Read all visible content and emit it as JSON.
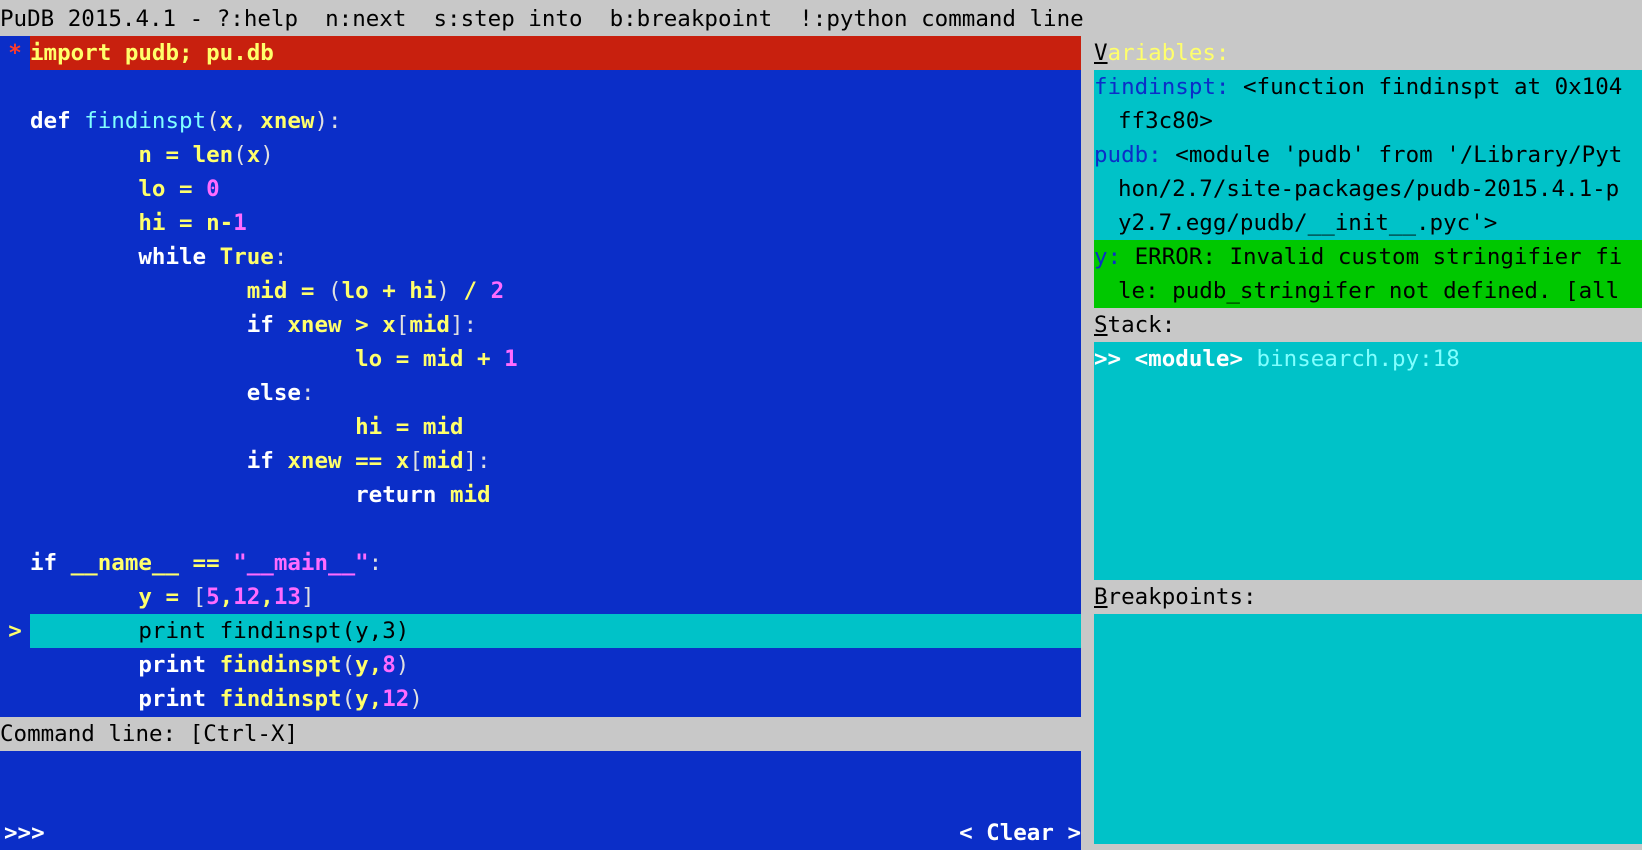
{
  "titlebar": {
    "text": "PuDB 2015.4.1 - ?:help  n:next  s:step into  b:breakpoint  !:python command line"
  },
  "code": {
    "lines": [
      {
        "gutter": "*",
        "kind": "bp",
        "tokens": [
          [
            "bp",
            "import pudb; pu.db"
          ]
        ]
      },
      {
        "gutter": "",
        "kind": "",
        "tokens": []
      },
      {
        "gutter": "",
        "kind": "",
        "tokens": [
          [
            "kw",
            "def "
          ],
          [
            "fn",
            "findinspt"
          ],
          [
            "pu",
            "("
          ],
          [
            "id",
            "x"
          ],
          [
            "pu",
            ", "
          ],
          [
            "id",
            "xnew"
          ],
          [
            "pu",
            "):"
          ]
        ]
      },
      {
        "gutter": "",
        "kind": "",
        "tokens": [
          [
            "pu",
            "        "
          ],
          [
            "id",
            "n"
          ],
          [
            "id",
            " = "
          ],
          [
            "id",
            "len"
          ],
          [
            "pu",
            "("
          ],
          [
            "id",
            "x"
          ],
          [
            "pu",
            ")"
          ]
        ]
      },
      {
        "gutter": "",
        "kind": "",
        "tokens": [
          [
            "pu",
            "        "
          ],
          [
            "id",
            "lo"
          ],
          [
            "id",
            " = "
          ],
          [
            "nm",
            "0"
          ]
        ]
      },
      {
        "gutter": "",
        "kind": "",
        "tokens": [
          [
            "pu",
            "        "
          ],
          [
            "id",
            "hi"
          ],
          [
            "id",
            " = "
          ],
          [
            "id",
            "n-"
          ],
          [
            "nm",
            "1"
          ]
        ]
      },
      {
        "gutter": "",
        "kind": "",
        "tokens": [
          [
            "pu",
            "        "
          ],
          [
            "kw",
            "while "
          ],
          [
            "id",
            "True"
          ],
          [
            "pu",
            ":"
          ]
        ]
      },
      {
        "gutter": "",
        "kind": "",
        "tokens": [
          [
            "pu",
            "                "
          ],
          [
            "id",
            "mid"
          ],
          [
            "id",
            " = "
          ],
          [
            "pu",
            "("
          ],
          [
            "id",
            "lo + hi"
          ],
          [
            "pu",
            ")"
          ],
          [
            "id",
            " / "
          ],
          [
            "nm",
            "2"
          ]
        ]
      },
      {
        "gutter": "",
        "kind": "",
        "tokens": [
          [
            "pu",
            "                "
          ],
          [
            "kw",
            "if "
          ],
          [
            "id",
            "xnew"
          ],
          [
            "id",
            " > "
          ],
          [
            "id",
            "x"
          ],
          [
            "pu",
            "["
          ],
          [
            "id",
            "mid"
          ],
          [
            "pu",
            "]:"
          ]
        ]
      },
      {
        "gutter": "",
        "kind": "",
        "tokens": [
          [
            "pu",
            "                        "
          ],
          [
            "id",
            "lo"
          ],
          [
            "id",
            " = "
          ],
          [
            "id",
            "mid + "
          ],
          [
            "nm",
            "1"
          ]
        ]
      },
      {
        "gutter": "",
        "kind": "",
        "tokens": [
          [
            "pu",
            "                "
          ],
          [
            "kw",
            "else"
          ],
          [
            "pu",
            ":"
          ]
        ]
      },
      {
        "gutter": "",
        "kind": "",
        "tokens": [
          [
            "pu",
            "                        "
          ],
          [
            "id",
            "hi"
          ],
          [
            "id",
            " = "
          ],
          [
            "id",
            "mid"
          ]
        ]
      },
      {
        "gutter": "",
        "kind": "",
        "tokens": [
          [
            "pu",
            "                "
          ],
          [
            "kw",
            "if "
          ],
          [
            "id",
            "xnew"
          ],
          [
            "id",
            " == "
          ],
          [
            "id",
            "x"
          ],
          [
            "pu",
            "["
          ],
          [
            "id",
            "mid"
          ],
          [
            "pu",
            "]:"
          ]
        ]
      },
      {
        "gutter": "",
        "kind": "",
        "tokens": [
          [
            "pu",
            "                        "
          ],
          [
            "kw",
            "return "
          ],
          [
            "id",
            "mid"
          ]
        ]
      },
      {
        "gutter": "",
        "kind": "",
        "tokens": []
      },
      {
        "gutter": "",
        "kind": "",
        "tokens": [
          [
            "kw",
            "if "
          ],
          [
            "id",
            "__name__"
          ],
          [
            "id",
            " == "
          ],
          [
            "st",
            "\"__main__\""
          ],
          [
            "pu",
            ":"
          ]
        ]
      },
      {
        "gutter": "",
        "kind": "",
        "tokens": [
          [
            "pu",
            "        "
          ],
          [
            "id",
            "y"
          ],
          [
            "id",
            " = "
          ],
          [
            "pu",
            "["
          ],
          [
            "nm",
            "5"
          ],
          [
            "id",
            ","
          ],
          [
            "nm",
            "12"
          ],
          [
            "id",
            ","
          ],
          [
            "nm",
            "13"
          ],
          [
            "pu",
            "]"
          ]
        ]
      },
      {
        "gutter": ">",
        "kind": "cur",
        "tokens": [
          [
            "pu",
            "        "
          ],
          [
            "cur",
            "print findinspt(y,3)"
          ]
        ]
      },
      {
        "gutter": "",
        "kind": "",
        "tokens": [
          [
            "pu",
            "        "
          ],
          [
            "kw",
            "print "
          ],
          [
            "id",
            "findinspt"
          ],
          [
            "pu",
            "("
          ],
          [
            "id",
            "y"
          ],
          [
            "id",
            ","
          ],
          [
            "nm",
            "8"
          ],
          [
            "pu",
            ")"
          ]
        ]
      },
      {
        "gutter": "",
        "kind": "",
        "tokens": [
          [
            "pu",
            "        "
          ],
          [
            "kw",
            "print "
          ],
          [
            "id",
            "findinspt"
          ],
          [
            "pu",
            "("
          ],
          [
            "id",
            "y"
          ],
          [
            "id",
            ","
          ],
          [
            "nm",
            "12"
          ],
          [
            "pu",
            ")"
          ]
        ]
      }
    ]
  },
  "command": {
    "header": "Command line: [Ctrl-X]",
    "prompt": ">>>",
    "clear_label": "< Clear  >"
  },
  "variables": {
    "header_first": "V",
    "header_rest": "ariables:",
    "items": [
      {
        "name": "findinspt:",
        "value": " <function findinspt at 0x104",
        "cont": "ff3c80>",
        "error": false
      },
      {
        "name": "pudb:",
        "value": " <module 'pudb' from '/Library/Pyt",
        "cont": "hon/2.7/site-packages/pudb-2015.4.1-p",
        "cont2": "y2.7.egg/pudb/__init__.pyc'>",
        "error": false
      },
      {
        "name": "y:",
        "value": " ERROR: Invalid custom stringifier fi",
        "cont": "le: pudb_stringifer not defined. [all",
        "error": true
      }
    ]
  },
  "stack": {
    "header_first": "S",
    "header_rest": "tack:",
    "entries": [
      {
        "marker": ">> ",
        "frame": "<module>",
        "location": " binsearch.py:18"
      }
    ]
  },
  "breakpoints": {
    "header_first": "B",
    "header_rest": "reakpoints:"
  },
  "colors": {
    "code_bg": "#0b2ec8",
    "current_line": "#00c2c8",
    "breakpoint_line": "#c8200e",
    "panel_bg": "#00c2c8",
    "error_bg": "#00c800",
    "bar_bg": "#c8c8c8"
  }
}
